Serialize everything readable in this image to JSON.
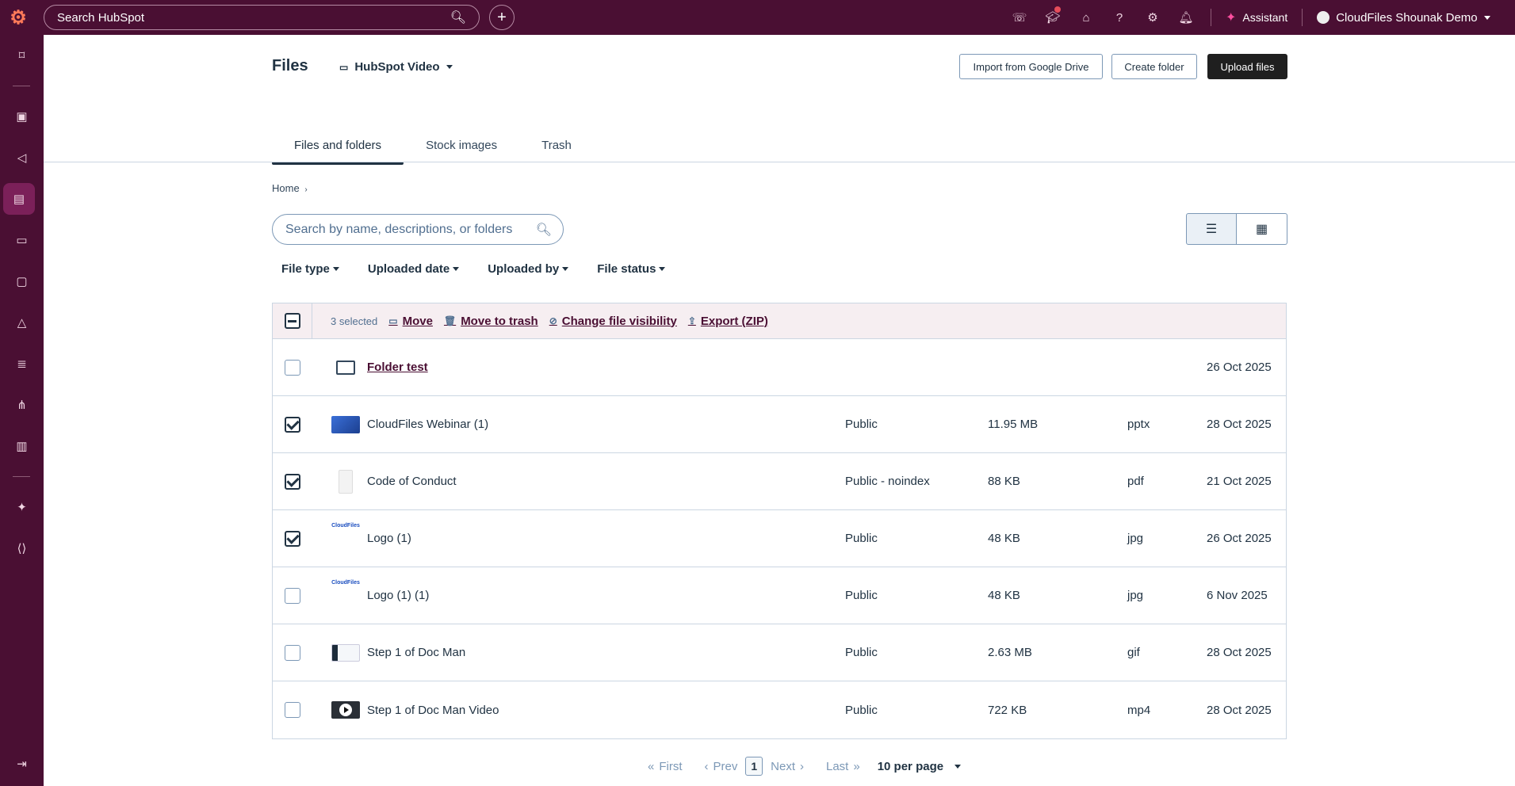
{
  "topbar": {
    "search_placeholder": "Search HubSpot",
    "assistant_label": "Assistant",
    "account_label": "CloudFiles Shounak Demo"
  },
  "header": {
    "title": "Files",
    "video_selector": "HubSpot Video",
    "import_label": "Import from Google Drive",
    "create_folder_label": "Create folder",
    "upload_label": "Upload files"
  },
  "tabs": [
    {
      "label": "Files and folders"
    },
    {
      "label": "Stock images"
    },
    {
      "label": "Trash"
    }
  ],
  "breadcrumb": "Home",
  "search": {
    "placeholder": "Search by name, descriptions, or folders"
  },
  "filters": [
    {
      "label": "File type"
    },
    {
      "label": "Uploaded date"
    },
    {
      "label": "Uploaded by"
    },
    {
      "label": "File status"
    }
  ],
  "bulk": {
    "selected_text": "3 selected",
    "move": "Move",
    "trash": "Move to trash",
    "visibility": "Change file visibility",
    "export": "Export (ZIP)"
  },
  "rows": [
    {
      "name": "Folder test",
      "visibility": "",
      "size": "",
      "ext": "",
      "date": "26 Oct 2025",
      "checked": false
    },
    {
      "name": "CloudFiles Webinar (1)",
      "visibility": "Public",
      "size": "11.95 MB",
      "ext": "pptx",
      "date": "28 Oct 2025",
      "checked": true
    },
    {
      "name": "Code of Conduct",
      "visibility": "Public - noindex",
      "size": "88 KB",
      "ext": "pdf",
      "date": "21 Oct 2025",
      "checked": true
    },
    {
      "name": "Logo (1)",
      "visibility": "Public",
      "size": "48 KB",
      "ext": "jpg",
      "date": "26 Oct 2025",
      "checked": true
    },
    {
      "name": "Logo (1) (1)",
      "visibility": "Public",
      "size": "48 KB",
      "ext": "jpg",
      "date": "6 Nov 2025",
      "checked": false
    },
    {
      "name": "Step 1 of Doc Man",
      "visibility": "Public",
      "size": "2.63 MB",
      "ext": "gif",
      "date": "28 Oct 2025",
      "checked": false
    },
    {
      "name": "Step 1 of Doc Man Video",
      "visibility": "Public",
      "size": "722 KB",
      "ext": "mp4",
      "date": "28 Oct 2025",
      "checked": false
    }
  ],
  "logo_text": "CloudFiles",
  "pagination": {
    "first": "First",
    "prev": "Prev",
    "current": "1",
    "next": "Next",
    "last": "Last",
    "per_page": "10 per page"
  }
}
